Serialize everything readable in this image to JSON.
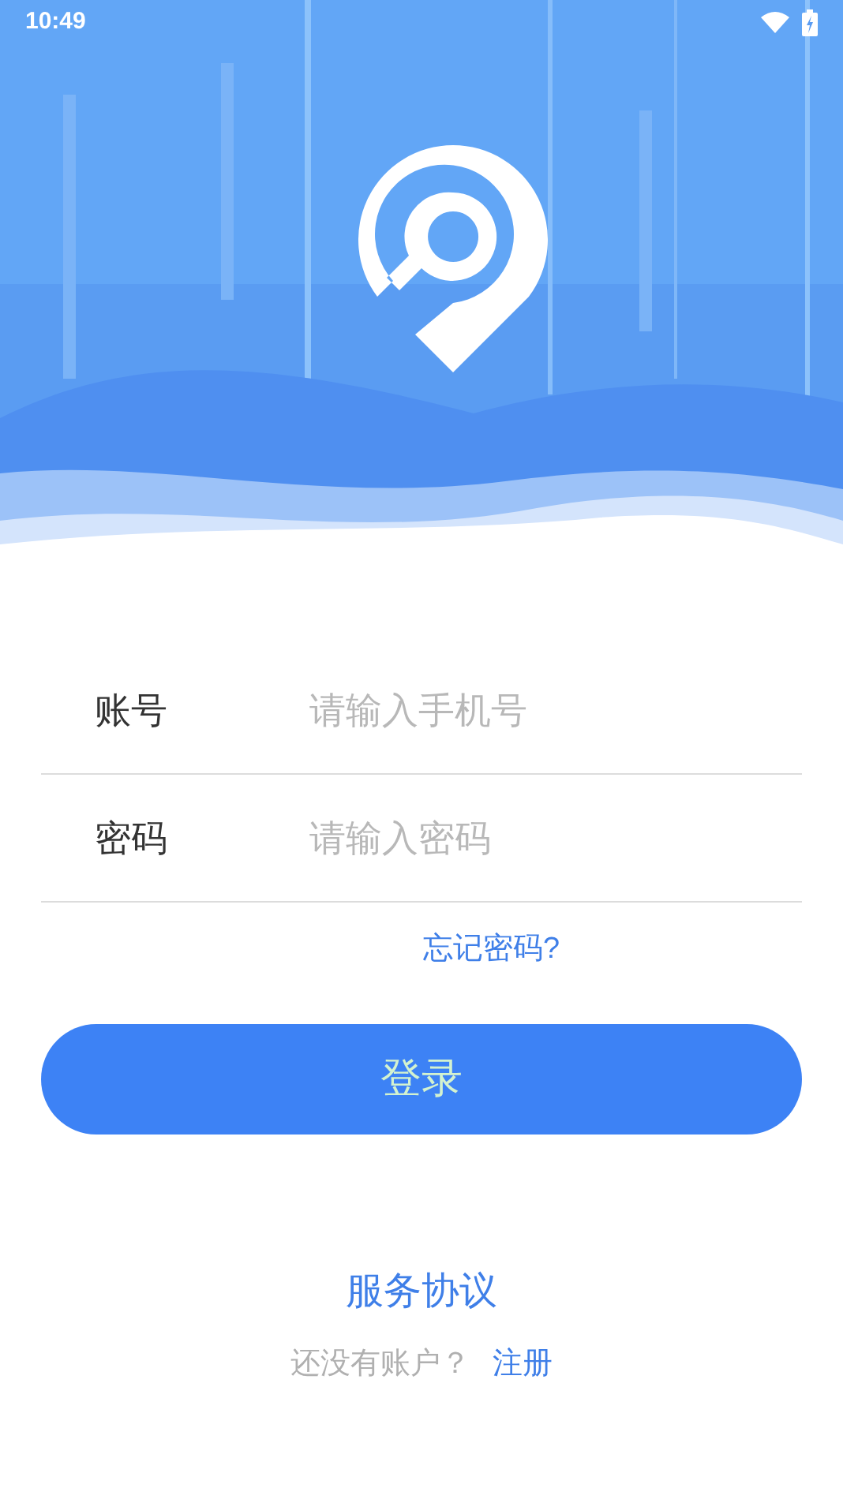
{
  "status_bar": {
    "time": "10:49"
  },
  "fields": [
    {
      "label": "账号",
      "placeholder": "请输入手机号"
    },
    {
      "label": "密码",
      "placeholder": "请输入密码"
    }
  ],
  "forgot_link": "忘记密码?",
  "login_button": "登录",
  "agreement_link": "服务协议",
  "signup": {
    "prompt": "还没有账户？",
    "link": "注册"
  }
}
